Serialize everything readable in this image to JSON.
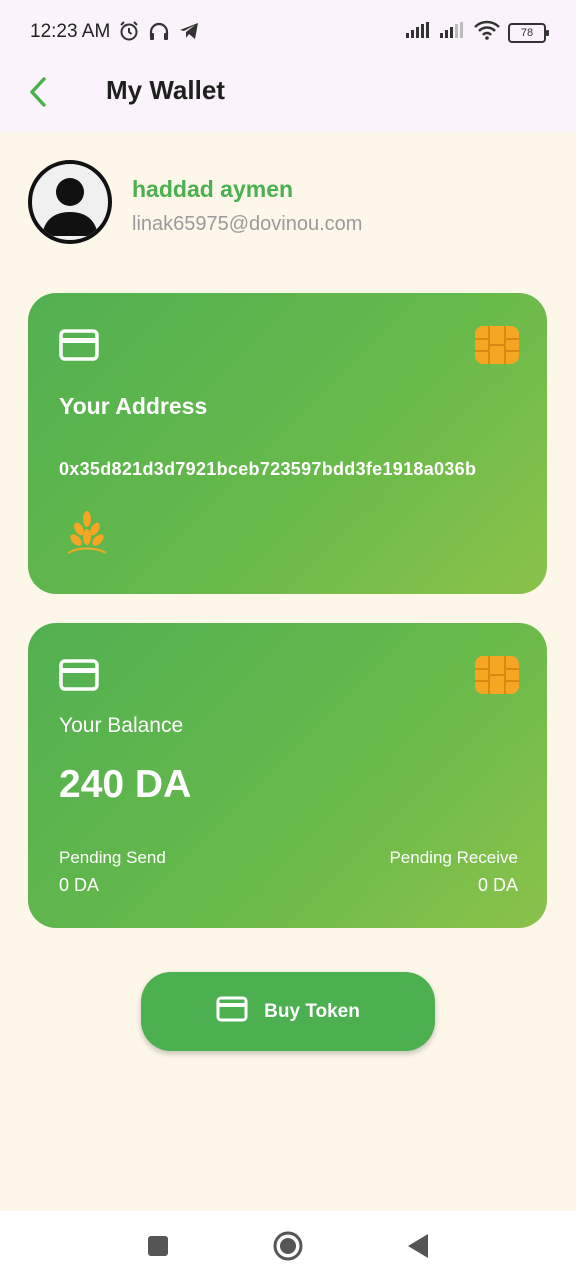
{
  "status_bar": {
    "time": "12:23 AM",
    "battery": "78",
    "icons_left": [
      "alarm-icon",
      "headphones-icon",
      "telegram-icon"
    ],
    "icons_right": [
      "signal-icon",
      "signal-icon",
      "wifi-icon",
      "battery-icon"
    ]
  },
  "app_bar": {
    "title": "My Wallet",
    "back_icon": "chevron-left-icon"
  },
  "profile": {
    "name": "haddad aymen",
    "email": "linak65975@dovinou.com"
  },
  "address_card": {
    "heading": "Your Address",
    "address": "0x35d821d3d7921bceb723597bdd3fe1918a036b",
    "icons": [
      "credit-card-icon",
      "chip-icon",
      "wheat-icon"
    ]
  },
  "balance_card": {
    "label": "Your Balance",
    "amount": "240 DA",
    "pending_send_label": "Pending Send",
    "pending_send_value": "0 DA",
    "pending_receive_label": "Pending Receive",
    "pending_receive_value": "0 DA",
    "icons": [
      "credit-card-icon",
      "chip-icon"
    ]
  },
  "buy_button": {
    "label": "Buy Token",
    "icon": "credit-card-icon"
  },
  "colors": {
    "accent": "#4caf50",
    "chip": "#f5a623",
    "background": "#fdf7ea",
    "header": "#fbf3fb"
  },
  "nav_bar": {
    "buttons": [
      "recent-apps-button",
      "home-button",
      "back-nav-button"
    ]
  }
}
